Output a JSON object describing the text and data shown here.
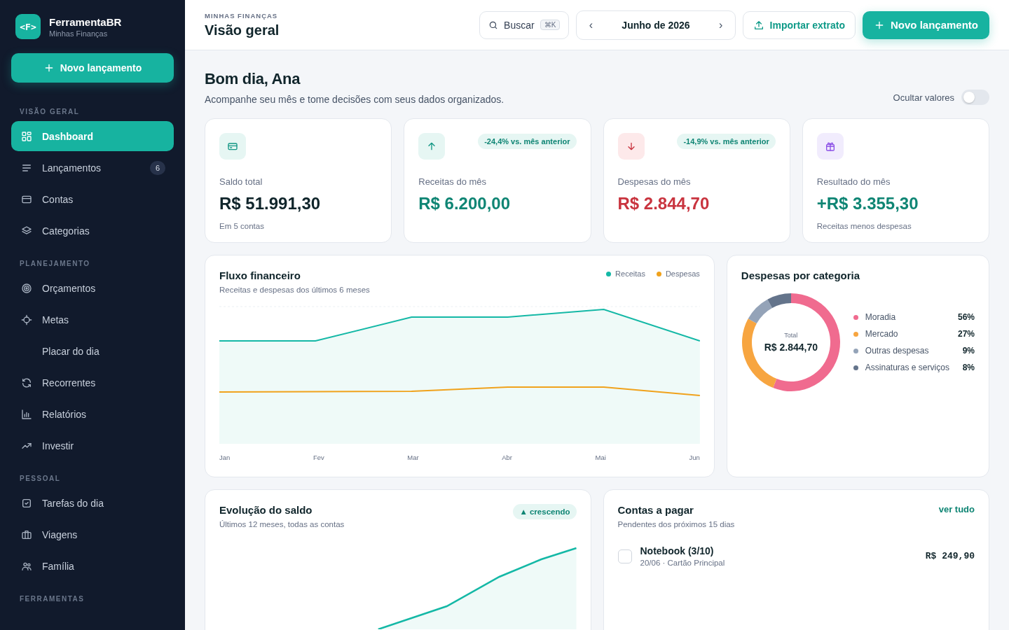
{
  "brand": {
    "logo": "<F>",
    "name": "FerramentaBR",
    "subtitle": "Minhas Finanças"
  },
  "sidebar": {
    "new_button": "Novo lançamento",
    "sections": [
      {
        "title": "VISÃO GERAL",
        "items": [
          {
            "label": "Dashboard",
            "selected": true
          },
          {
            "label": "Lançamentos",
            "selected": false,
            "badge": "6"
          },
          {
            "label": "Contas",
            "selected": false
          },
          {
            "label": "Categorias",
            "selected": false
          }
        ]
      },
      {
        "title": "PLANEJAMENTO",
        "items": [
          {
            "label": "Orçamentos",
            "selected": false
          },
          {
            "label": "Metas",
            "selected": false
          },
          {
            "label": "Placar do dia",
            "selected": false
          },
          {
            "label": "Recorrentes",
            "selected": false
          },
          {
            "label": "Relatórios",
            "selected": false
          },
          {
            "label": "Investir",
            "selected": false
          }
        ]
      },
      {
        "title": "PESSOAL",
        "items": [
          {
            "label": "Tarefas do dia",
            "selected": false
          },
          {
            "label": "Viagens",
            "selected": false
          },
          {
            "label": "Família",
            "selected": false
          }
        ]
      },
      {
        "title": "FERRAMENTAS"
      }
    ]
  },
  "header": {
    "eyebrow": "MINHAS FINANÇAS",
    "title": "Visão geral",
    "search": {
      "label": "Buscar",
      "shortcut": "⌘K"
    },
    "month": {
      "prev": "‹",
      "label": "Junho de 2026",
      "next": "›"
    },
    "import_button": "Importar extrato",
    "new_button": "Novo lançamento"
  },
  "greeting": {
    "title": "Bom dia, Ana",
    "subtitle": "Acompanhe seu mês e tome decisões com seus dados organizados.",
    "hide_values": {
      "label": "Ocultar valores",
      "on": false
    }
  },
  "stats": [
    {
      "kind": "balance",
      "label": "Saldo total",
      "value": "R$ 51.991,30",
      "note": "Em 5 contas"
    },
    {
      "kind": "income",
      "label": "Receitas do mês",
      "value": "R$ 6.200,00",
      "badge": "-24,4% vs. mês anterior"
    },
    {
      "kind": "expense",
      "label": "Despesas do mês",
      "value": "R$ 2.844,70",
      "badge": "-14,9% vs. mês anterior"
    },
    {
      "kind": "result",
      "label": "Resultado do mês",
      "value": "+R$ 3.355,30",
      "note": "Receitas menos despesas"
    }
  ],
  "cash_flow": {
    "title": "Fluxo financeiro",
    "subtitle": "Receitas e despesas dos últimos 6 meses",
    "legend": [
      {
        "label": "Receitas",
        "color": "#14b8a6"
      },
      {
        "label": "Despesas",
        "color": "#f0a21c"
      }
    ],
    "months": [
      "Jan",
      "Fev",
      "Mar",
      "Abr",
      "Mai",
      "Jun"
    ]
  },
  "categories": {
    "title": "Despesas por categoria",
    "total_label": "Total",
    "total": "R$ 2.844,70",
    "chart_data": {
      "type": "donut",
      "categories": [
        "Moradia",
        "Mercado",
        "Outras despesas",
        "Assinaturas e serviços"
      ],
      "values": [
        56,
        27,
        9,
        8
      ],
      "value_labels": [
        "56%",
        "27%",
        "9%",
        "8%"
      ],
      "colors": [
        "#f06b8f",
        "#f7a540",
        "#94a3b8",
        "#64748b"
      ]
    }
  },
  "balance": {
    "title": "Evolução do saldo",
    "subtitle": "Últimos 12 meses, todas as contas",
    "badge": "▲ crescendo"
  },
  "bills": {
    "title": "Contas a pagar",
    "subtitle": "Pendentes dos próximos 15 dias",
    "link": "ver tudo",
    "items": [
      {
        "name": "Notebook (3/10)",
        "meta": "20/06 · Cartão Principal",
        "amount": "R$ 249,90",
        "checked": false
      }
    ]
  }
}
